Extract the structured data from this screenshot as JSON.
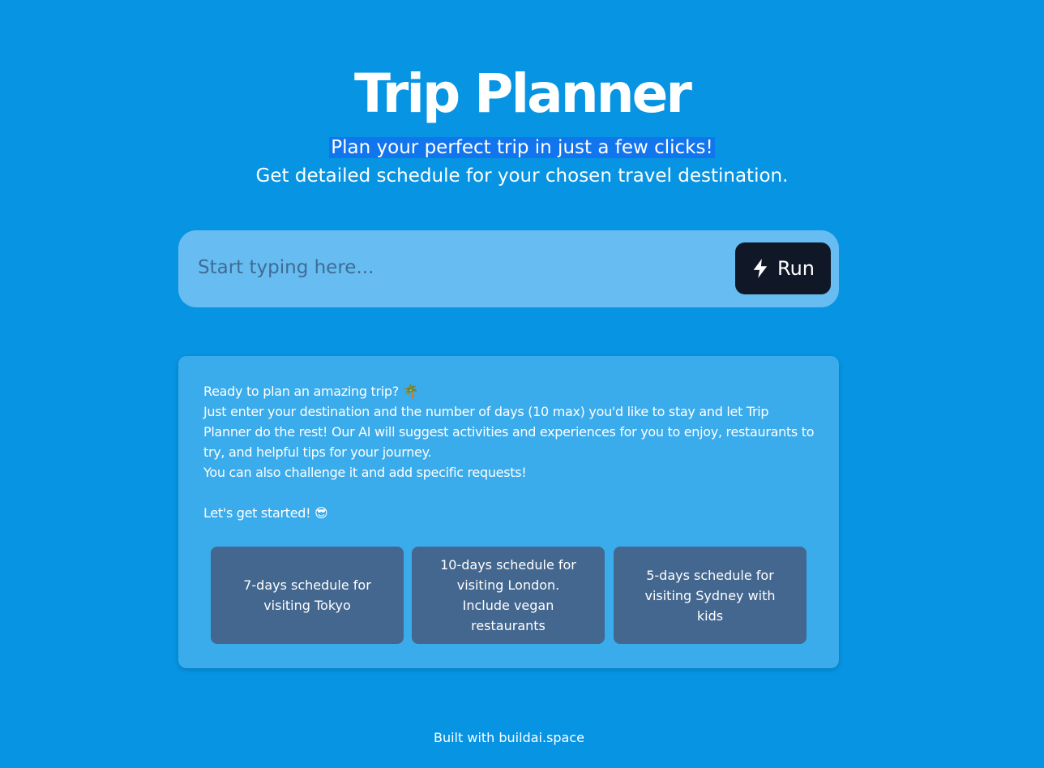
{
  "header": {
    "title": "Trip Planner",
    "subtitle_line1": "Plan your perfect trip in just a few clicks!",
    "subtitle_line2": "Get detailed schedule for your chosen travel destination."
  },
  "search": {
    "placeholder": "Start typing here...",
    "value": "",
    "run_label": "Run",
    "run_icon": "lightning-bolt-icon"
  },
  "intro": {
    "line1": "Ready to plan an amazing trip? 🌴",
    "line2": "Just enter your destination and the number of days (10 max) you'd like to stay and let Trip Planner do the rest! Our AI will suggest activities and experiences for you to enjoy, restaurants to try, and helpful tips for your journey.",
    "line3": "You can also challenge it and add specific requests!",
    "line4": "Let's get started! 😎"
  },
  "suggestions": [
    {
      "label": "7-days schedule for visiting Tokyo"
    },
    {
      "label": "10-days schedule for visiting London. Include vegan restaurants"
    },
    {
      "label": "5-days schedule for visiting Sydney with kids"
    }
  ],
  "footer": {
    "text": "Built with buildai.space"
  },
  "colors": {
    "background": "#0794e3",
    "search_bar": "#67bdf1",
    "run_button": "#101827",
    "card": "#3aabeb",
    "suggestion": "#44678f",
    "highlight": "#1175ee"
  }
}
